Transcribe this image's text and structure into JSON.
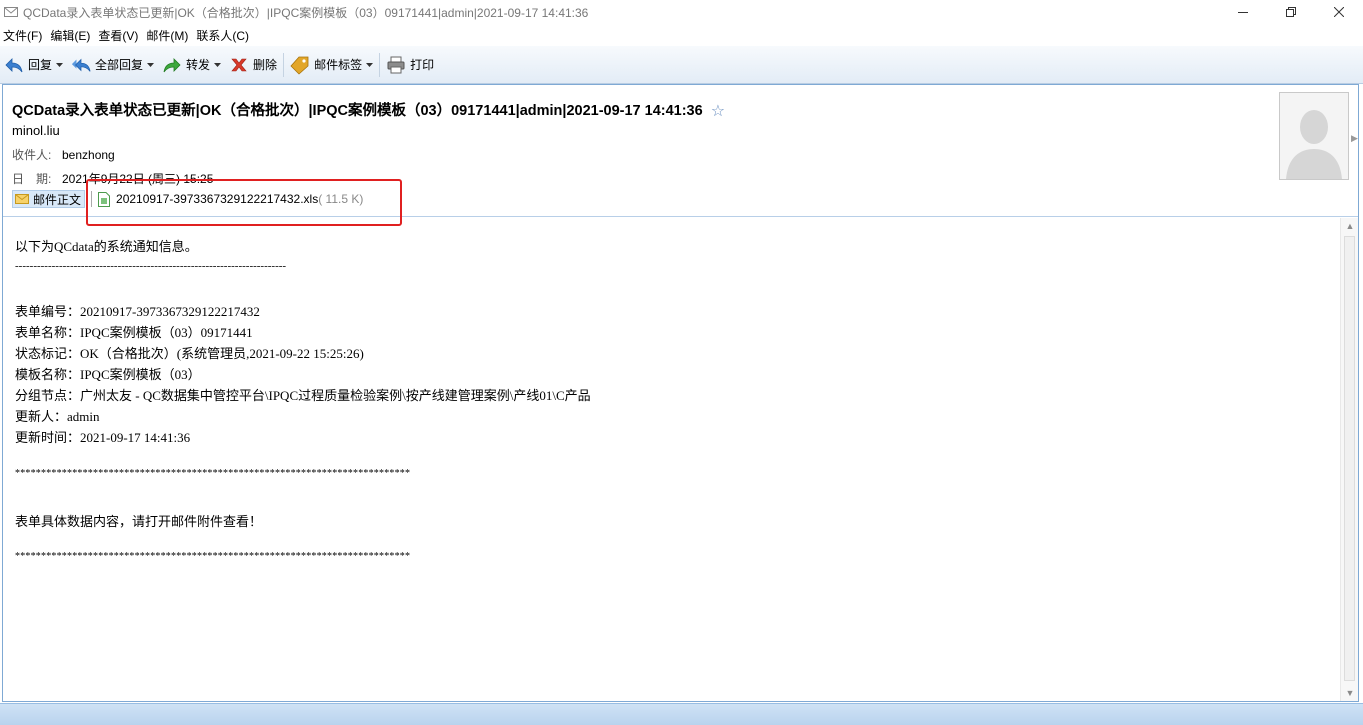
{
  "window": {
    "title": "QCData录入表单状态已更新|OK（合格批次）|IPQC案例模板（03）09171441|admin|2021-09-17 14:41:36"
  },
  "menu": [
    "文件(F)",
    "编辑(E)",
    "查看(V)",
    "邮件(M)",
    "联系人(C)"
  ],
  "toolbar": {
    "reply": "回复",
    "reply_all": "全部回复",
    "forward": "转发",
    "delete": "删除",
    "mail_tag": "邮件标签",
    "print": "打印"
  },
  "message": {
    "subject": "QCData录入表单状态已更新|OK（合格批次）|IPQC案例模板（03）09171441|admin|2021-09-17 14:41:36",
    "star": "☆",
    "sender": "minol.liu",
    "to_label": "收件人:",
    "to": "benzhong",
    "date_label": "日　期:",
    "date": "2021年9月22日 (周三) 15:25",
    "body_tab": "邮件正文",
    "attachment_name": "20210917-3973367329122217432.xls",
    "attachment_size": "( 11.5 K)"
  },
  "body_lines": {
    "l1": "以下为QCdata的系统通知信息。",
    "l2": "--------------------------------------------------------------------------",
    "l3": "表单编号：20210917-3973367329122217432",
    "l4": "表单名称：IPQC案例模板（03）09171441",
    "l5": "状态标记：OK（合格批次）(系统管理员,2021-09-22 15:25:26)",
    "l6": "模板名称：IPQC案例模板（03）",
    "l7": "分组节点：广州太友 - QC数据集中管控平台\\IPQC过程质量检验案例\\按产线建管理案例\\产线01\\C产品",
    "l8": "更新人：admin",
    "l9": "更新时间：2021-09-17 14:41:36",
    "l10": "****************************************************************************",
    "l11": "表单具体数据内容，请打开邮件附件查看！",
    "l12": "****************************************************************************"
  },
  "colors": {
    "frame_border": "#7fa9d4",
    "highlight": "#e02020",
    "toolbar_bg": "#e3ecf6"
  }
}
